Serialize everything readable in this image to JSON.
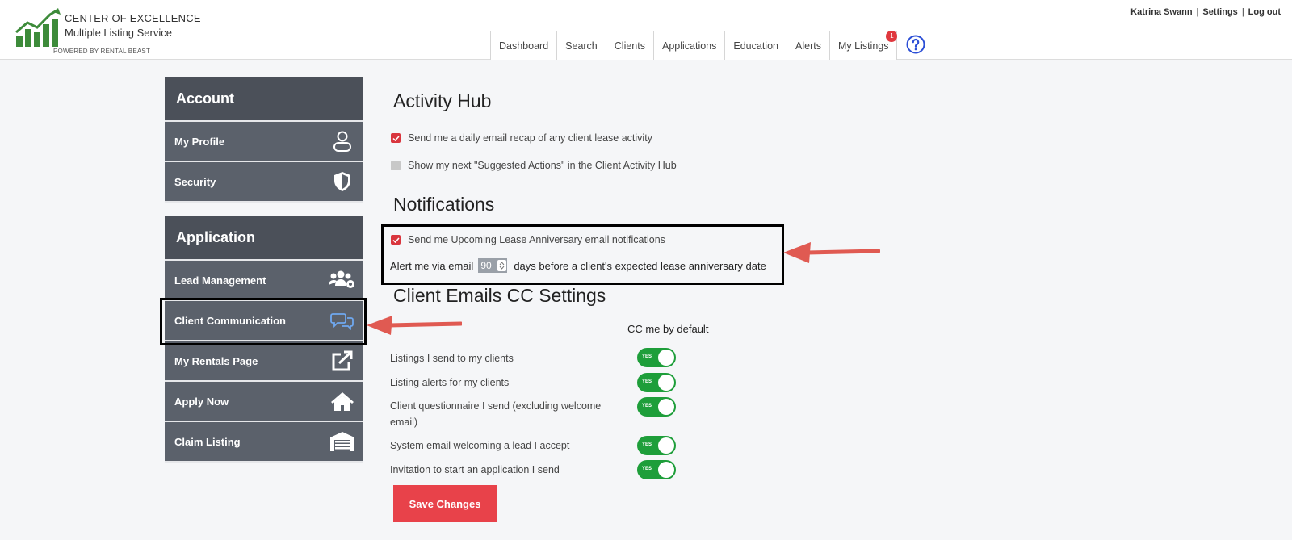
{
  "brand": {
    "line1": "CENTER OF  EXCELLENCE",
    "line2": "Multiple Listing Service",
    "line3": "POWERED BY RENTAL BEAST"
  },
  "user_links": {
    "name": "Katrina Swann",
    "settings": "Settings",
    "logout": "Log out"
  },
  "nav": {
    "tabs": [
      "Dashboard",
      "Search",
      "Clients",
      "Applications",
      "Education",
      "Alerts",
      "My Listings"
    ],
    "listings_badge": "1",
    "help_icon": "question-circle-icon"
  },
  "sidebar": {
    "account_header": "Account",
    "account_items": [
      {
        "label": "My Profile",
        "icon": "user-icon"
      },
      {
        "label": "Security",
        "icon": "shield-icon"
      }
    ],
    "application_header": "Application",
    "application_items": [
      {
        "label": "Lead Management",
        "icon": "users-gear-icon"
      },
      {
        "label": "Client Communication",
        "icon": "chat-bubbles-icon",
        "active": true
      },
      {
        "label": "My Rentals Page",
        "icon": "external-link-icon"
      },
      {
        "label": "Apply Now",
        "icon": "home-icon"
      },
      {
        "label": "Claim Listing",
        "icon": "garage-icon"
      }
    ]
  },
  "activity_hub": {
    "title": "Activity Hub",
    "daily_recap": {
      "label": "Send me a daily email recap of any client lease activity",
      "checked": true
    },
    "suggested_actions": {
      "label": "Show my next \"Suggested Actions\" in the Client Activity Hub",
      "checked": false
    }
  },
  "notifications": {
    "title": "Notifications",
    "anniversary": {
      "label": "Send me Upcoming Lease Anniversary email notifications",
      "checked": true
    },
    "alert_prefix": "Alert me via email",
    "alert_days": "90",
    "alert_suffix": "days before a client's expected lease anniversary date"
  },
  "cc_settings": {
    "title": "Client Emails CC Settings",
    "column_header": "CC me by default",
    "rows": [
      {
        "label": "Listings I send to my clients",
        "toggle": "YES",
        "on": true
      },
      {
        "label": "Listing alerts for my clients",
        "toggle": "YES",
        "on": true
      },
      {
        "label": "Client questionnaire I send (excluding welcome email)",
        "toggle": "YES",
        "on": true
      },
      {
        "label": "System email welcoming a lead I accept",
        "toggle": "YES",
        "on": true
      },
      {
        "label": "Invitation to start an application I send",
        "toggle": "YES",
        "on": true
      }
    ]
  },
  "save_label": "Save Changes",
  "colors": {
    "accent_red": "#e8424a",
    "toggle_green": "#1e9e3a",
    "sidebar_dark": "#4b5059",
    "arrow_red": "#e05a52"
  }
}
